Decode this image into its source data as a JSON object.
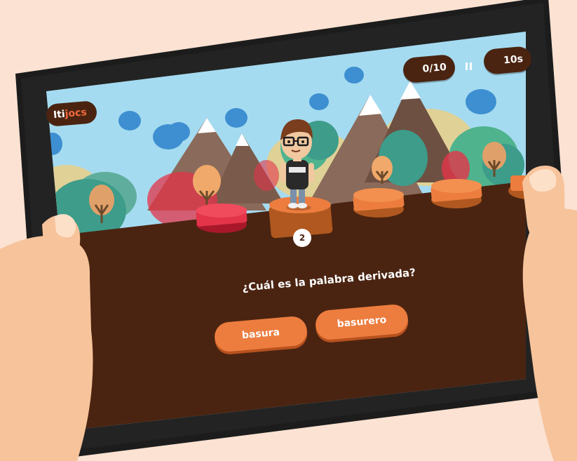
{
  "app": {
    "logo_prefix": "Iti",
    "logo_suffix": "jocs"
  },
  "hud": {
    "score": "0/10",
    "timer": "10s"
  },
  "progress": {
    "current_step": "2",
    "steps_total": 5,
    "step_states": [
      "wrong",
      "current",
      "pending",
      "pending",
      "pending"
    ]
  },
  "quiz": {
    "question": "¿Cuál es la palabra derivada?",
    "options": [
      "basura",
      "basurero"
    ]
  },
  "colors": {
    "background": "#fbe2d2",
    "tablet_frame": "#1c1c1c",
    "ground": "#4a2411",
    "sky": "#a5dbf0",
    "answer_button": "#ec7d3f",
    "wrong_platform": "#e3344a",
    "hud_pill": "#4a2411",
    "check": "#8bc34a",
    "timer_icon": "#f5a623"
  }
}
